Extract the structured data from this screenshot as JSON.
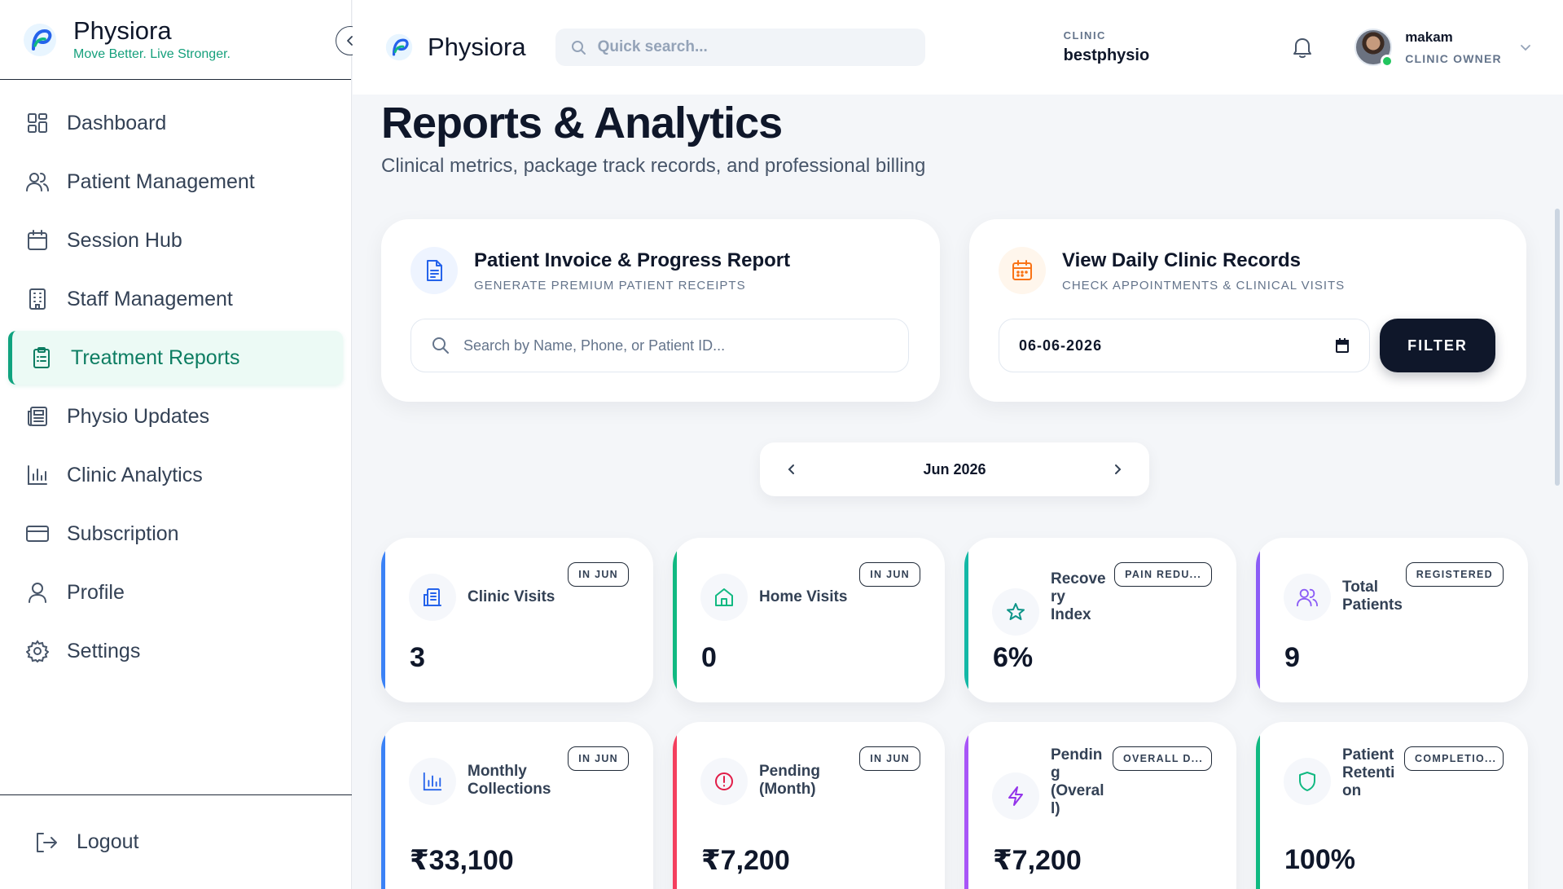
{
  "brand": {
    "name": "Physiora",
    "tagline": "Move Better. Live Stronger."
  },
  "sidebar": {
    "items": [
      {
        "label": "Dashboard",
        "icon": "dashboard-icon"
      },
      {
        "label": "Patient Management",
        "icon": "users-icon"
      },
      {
        "label": "Session Hub",
        "icon": "calendar-icon"
      },
      {
        "label": "Staff Management",
        "icon": "building-icon"
      },
      {
        "label": "Treatment Reports",
        "icon": "clipboard-icon",
        "active": true
      },
      {
        "label": "Physio Updates",
        "icon": "newspaper-icon"
      },
      {
        "label": "Clinic Analytics",
        "icon": "bar-chart-icon"
      },
      {
        "label": "Subscription",
        "icon": "credit-card-icon"
      },
      {
        "label": "Profile",
        "icon": "user-icon"
      },
      {
        "label": "Settings",
        "icon": "gear-icon"
      }
    ],
    "logout_label": "Logout"
  },
  "topbar": {
    "title": "Physiora",
    "search_placeholder": "Quick search...",
    "clinic_label": "CLINIC",
    "clinic_name": "bestphysio",
    "user_name": "makam",
    "user_role": "CLINIC OWNER"
  },
  "page": {
    "title": "Reports & Analytics",
    "subtitle": "Clinical metrics, package track records, and professional billing"
  },
  "invoice_panel": {
    "title": "Patient Invoice & Progress Report",
    "subtitle": "Generate premium patient receipts",
    "search_placeholder": "Search by Name, Phone, or Patient ID..."
  },
  "daily_panel": {
    "title": "View Daily Clinic Records",
    "subtitle": "Check appointments & clinical visits",
    "date_value": "06-06-2026",
    "filter_label": "FILTER"
  },
  "month_nav": {
    "label": "Jun 2026"
  },
  "stats": [
    {
      "label": "Clinic Visits",
      "badge": "IN JUN",
      "value": "3",
      "accent": "#3b82f6",
      "icon": "clinic-building-icon"
    },
    {
      "label": "Home Visits",
      "badge": "IN JUN",
      "value": "0",
      "accent": "#10b981",
      "icon": "home-icon"
    },
    {
      "label": "Recove\nry\nIndex",
      "badge": "PAIN REDU...",
      "value": "6%",
      "accent": "#14b8a6",
      "icon": "star-icon"
    },
    {
      "label": "Total\nPatients",
      "badge": "REGISTERED",
      "value": "9",
      "accent": "#8b5cf6",
      "icon": "users-icon"
    },
    {
      "label": "Monthly\nCollections",
      "badge": "IN JUN",
      "value": "₹33,100",
      "accent": "#3b82f6",
      "icon": "bar-chart-icon"
    },
    {
      "label": "Pending\n(Month)",
      "badge": "IN JUN",
      "value": "₹7,200",
      "accent": "#f43f5e",
      "icon": "alert-circle-icon"
    },
    {
      "label": "Pendin\ng\n(Overal\nl)",
      "badge": "OVERALL D...",
      "value": "₹7,200",
      "accent": "#a855f7",
      "icon": "lightning-icon"
    },
    {
      "label": "Patient\nRetenti\non",
      "badge": "COMPLETIO...",
      "value": "100%",
      "accent": "#10b981",
      "icon": "shield-icon"
    }
  ]
}
